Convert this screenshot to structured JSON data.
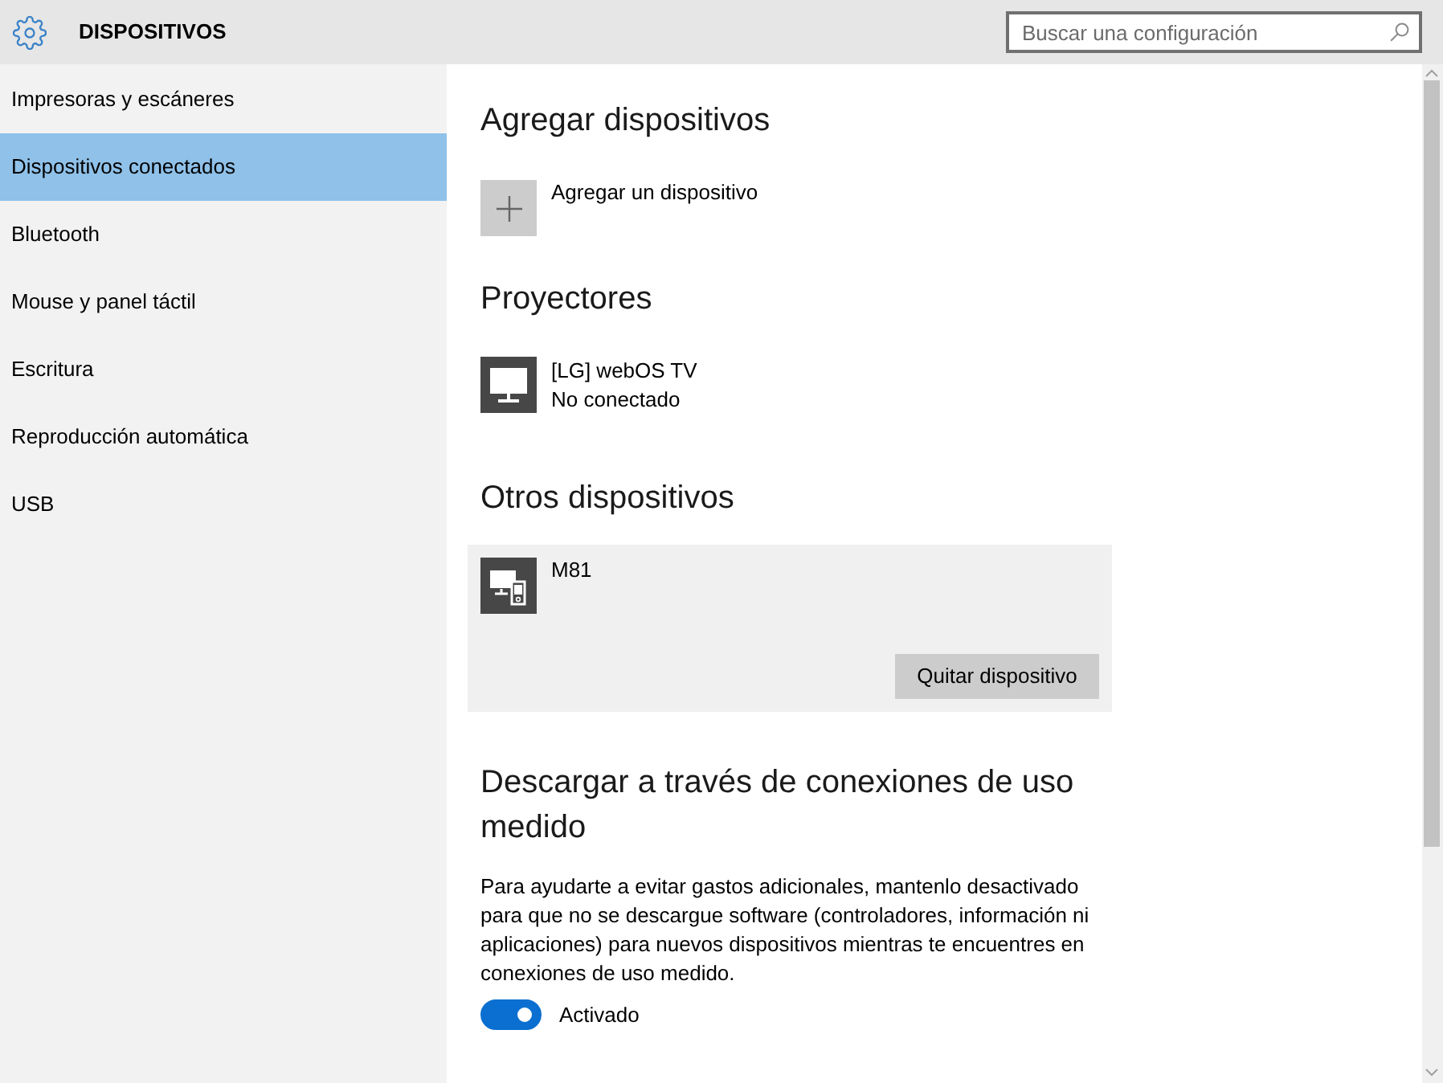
{
  "header": {
    "title": "DISPOSITIVOS",
    "search": {
      "placeholder": "Buscar una configuración"
    }
  },
  "sidebar": {
    "items": [
      {
        "label": "Impresoras y escáneres",
        "selected": false
      },
      {
        "label": "Dispositivos conectados",
        "selected": true
      },
      {
        "label": "Bluetooth",
        "selected": false
      },
      {
        "label": "Mouse y panel táctil",
        "selected": false
      },
      {
        "label": "Escritura",
        "selected": false
      },
      {
        "label": "Reproducción automática",
        "selected": false
      },
      {
        "label": "USB",
        "selected": false
      }
    ]
  },
  "add_devices": {
    "title": "Agregar dispositivos",
    "action": "Agregar un dispositivo"
  },
  "projectors": {
    "title": "Proyectores",
    "devices": [
      {
        "name": "[LG] webOS TV",
        "status": "No conectado"
      }
    ]
  },
  "other_devices": {
    "title": "Otros dispositivos",
    "devices": [
      {
        "name": "M81",
        "expanded": true,
        "button": "Quitar dispositivo"
      }
    ]
  },
  "metered": {
    "title": "Descargar a través de conexiones de uso medido",
    "description": "Para ayudarte a evitar gastos adicionales, mantenlo desactivado para que no se descargue software (controladores, información ni aplicaciones) para nuevos dispositivos mientras te encuentres en conexiones de uso medido.",
    "toggle": {
      "on": true,
      "label": "Activado"
    }
  }
}
